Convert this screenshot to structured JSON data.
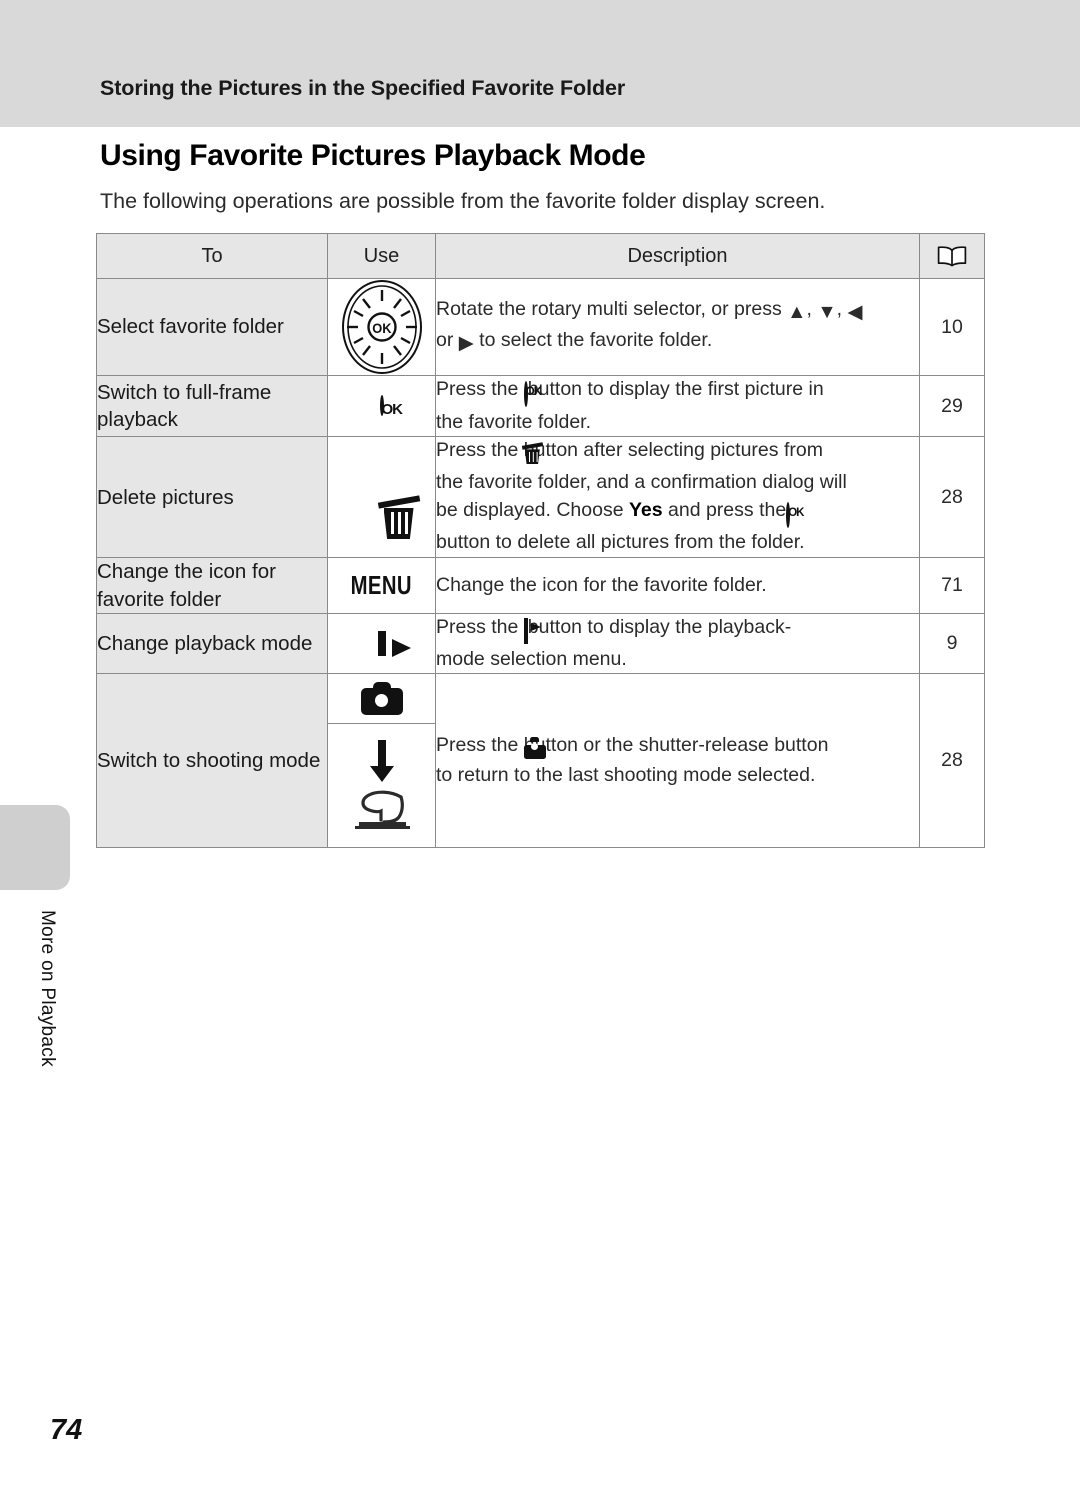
{
  "header": {
    "running_title": "Storing the Pictures in the Specified Favorite Folder"
  },
  "page": {
    "heading": "Using Favorite Pictures Playback Mode",
    "intro": "The following operations are possible from the favorite folder display screen.",
    "number": "74",
    "side_tab_label": "More on Playback"
  },
  "table": {
    "columns": {
      "to": "To",
      "use": "Use",
      "description": "Description",
      "reference_icon": "open-book-icon"
    },
    "rows": [
      {
        "to": "Select favorite folder",
        "use_icon": "rotary-multi-selector-icon",
        "description_lines": [
          "Rotate the rotary multi selector, or press ▲, ▼, ◀",
          "or ▶ to select the favorite folder."
        ],
        "reference": "10"
      },
      {
        "to": "Switch to full-frame playback",
        "use_icon": "ok-button-icon",
        "description_lines": [
          "Press the [OK] button to display the first picture in",
          "the favorite folder."
        ],
        "reference": "29"
      },
      {
        "to": "Delete pictures",
        "use_icon": "trash-icon",
        "description_lines": [
          "Press the [trash] button after selecting pictures from",
          "the favorite folder, and a confirmation dialog will",
          "be displayed. Choose Yes and press the [OK]",
          "button to delete all pictures from the folder."
        ],
        "emphasis": "Yes",
        "reference": "28"
      },
      {
        "to": "Change the icon for favorite folder",
        "use_icon": "menu-button-icon",
        "use_label": "MENU",
        "description_lines": [
          "Change the icon for the favorite folder."
        ],
        "reference": "71"
      },
      {
        "to": "Change playback mode",
        "use_icon": "playback-button-icon",
        "description_lines": [
          "Press the [playback] button to display the playback-",
          "mode selection menu."
        ],
        "reference": "9"
      },
      {
        "to": "Switch to shooting mode",
        "use_icon": "camera-button-icon",
        "use_icon_secondary": "down-arrow-icon",
        "use_icon_tertiary": "shutter-release-icon",
        "description_lines": [
          "Press the [camera] button or the shutter-release button",
          "to return to the last shooting mode selected."
        ],
        "reference": "28"
      }
    ]
  },
  "colors": {
    "header_band": "#d9d9d9",
    "table_header_fill": "#e6e6e6",
    "to_column_fill": "#e6e6e6",
    "border": "#8a8a8a",
    "side_tab": "#cfcfcf"
  }
}
